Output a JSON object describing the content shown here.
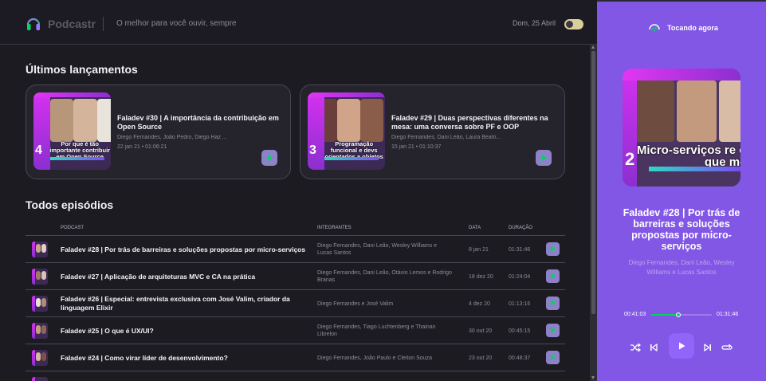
{
  "header": {
    "logo_text": "Podcastr",
    "tagline": "O melhor para você ouvir, sempre",
    "date": "Dom, 25 Abril"
  },
  "latest": {
    "heading": "Últimos lançamentos",
    "episodes": [
      {
        "title": "Faladev #30 | A importância da contribuição em Open Source",
        "members": "Diego Fernandes, João Pedro, Diego Haz ...",
        "meta": "22 jan 21 • 01:06:21",
        "thumb_caption": "Por que é tão importante contribuir em Open Source",
        "thumb_number": "4"
      },
      {
        "title": "Faladev #29 | Duas perspectivas diferentes na mesa: uma conversa sobre PF e OOP",
        "members": "Diego Fernandes, Dani Leão, Laura Beatri...",
        "meta": "15 jan 21 • 01:10:37",
        "thumb_caption": "Programação funcional e devs orientados a objetos",
        "thumb_number": "3"
      }
    ]
  },
  "all": {
    "heading": "Todos episódios",
    "columns": [
      "PODCAST",
      "INTEGRANTES",
      "DATA",
      "DURAÇÃO"
    ],
    "rows": [
      {
        "title": "Faladev #28 | Por trás de barreiras e soluções propostas por micro-serviços",
        "members": "Diego Fernandes, Dani Leão, Wesley Williams e Lucas Santos",
        "date": "8 jan 21",
        "duration": "01:31:46"
      },
      {
        "title": "Faladev #27 | Aplicação de arquiteturas MVC e CA na prática",
        "members": "Diego Fernandes, Dani Leão, Otávio Lemos e Rodrigo Branas",
        "date": "18 dez 20",
        "duration": "01:24:04"
      },
      {
        "title": "Faladev #26 | Especial: entrevista exclusiva com José Valim, criador da linguagem Elixir",
        "members": "Diego Fernandes e José Valim",
        "date": "4 dez 20",
        "duration": "01:13:16"
      },
      {
        "title": "Faladev #25 | O que é UX/UI?",
        "members": "Diego Fernandes, Tiago Luchtenberg e Thainan Librelon",
        "date": "30 out 20",
        "duration": "00:45:15"
      },
      {
        "title": "Faladev #24 | Como virar líder de desenvolvimento?",
        "members": "Diego Fernandes, João Paulo e Cleiton Souza",
        "date": "23 out 20",
        "duration": "00:48:37"
      }
    ]
  },
  "player": {
    "heading": "Tocando agora",
    "title": "Faladev #28 | Por trás de barreiras e soluções propostas por micro-serviços",
    "members": "Diego Fernandes, Dani Leão, Wesley Williams e Lucas Santos",
    "cover_caption": "Micro-serviços re o que me",
    "cover_number": "2",
    "current_time": "00:41:03",
    "total_time": "01:31:46",
    "progress": 0.45
  },
  "colors": {
    "accent": "#8257e5",
    "green": "#04d361",
    "background": "#1d1b22"
  },
  "icons": [
    "headphones-icon",
    "play-icon",
    "shuffle-icon",
    "previous-icon",
    "next-icon",
    "repeat-icon",
    "now-playing-icon",
    "theme-toggle"
  ]
}
